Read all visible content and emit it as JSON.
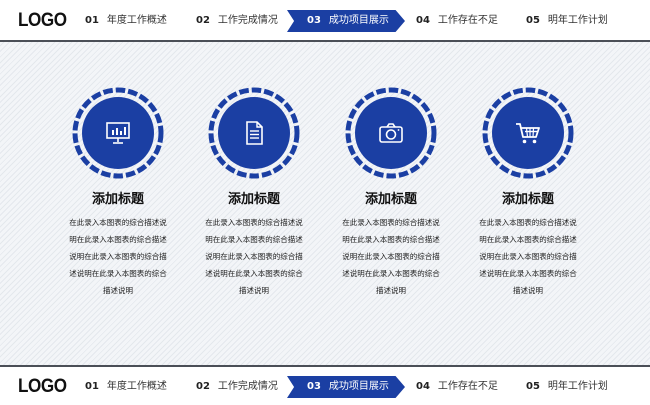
{
  "header": {
    "logo": "LOGO",
    "nav": [
      {
        "num": "01",
        "label": "年度工作概述"
      },
      {
        "num": "02",
        "label": "工作完成情况"
      },
      {
        "num": "03",
        "label": "成功项目展示"
      },
      {
        "num": "04",
        "label": "工作存在不足"
      },
      {
        "num": "05",
        "label": "明年工作计划"
      }
    ]
  },
  "footer": {
    "logo": "LOGO",
    "nav": [
      {
        "num": "01",
        "label": "年度工作概述"
      },
      {
        "num": "02",
        "label": "工作完成情况"
      },
      {
        "num": "03",
        "label": "成功项目展示"
      },
      {
        "num": "04",
        "label": "工作存在不足"
      },
      {
        "num": "05",
        "label": "明年工作计划"
      }
    ]
  },
  "features": [
    {
      "icon": "presentation-icon",
      "title": "添加标题",
      "body": "在此录入本图表的综合描述说明在此录入本图表的综合描述说明在此录入本图表的综合描述说明在此录入本图表的综合描述说明"
    },
    {
      "icon": "document-icon",
      "title": "添加标题",
      "body": "在此录入本图表的综合描述说明在此录入本图表的综合描述说明在此录入本图表的综合描述说明在此录入本图表的综合描述说明"
    },
    {
      "icon": "camera-icon",
      "title": "添加标题",
      "body": "在此录入本图表的综合描述说明在此录入本图表的综合描述说明在此录入本图表的综合描述说明在此录入本图表的综合描述说明"
    },
    {
      "icon": "shopping-cart-icon",
      "title": "添加标题",
      "body": "在此录入本图表的综合描述说明在此录入本图表的综合描述说明在此录入本图表的综合描述说明在此录入本图表的综合描述说明"
    }
  ],
  "colors": {
    "accent": "#1b3fa3",
    "divider": "#4b4f57"
  }
}
